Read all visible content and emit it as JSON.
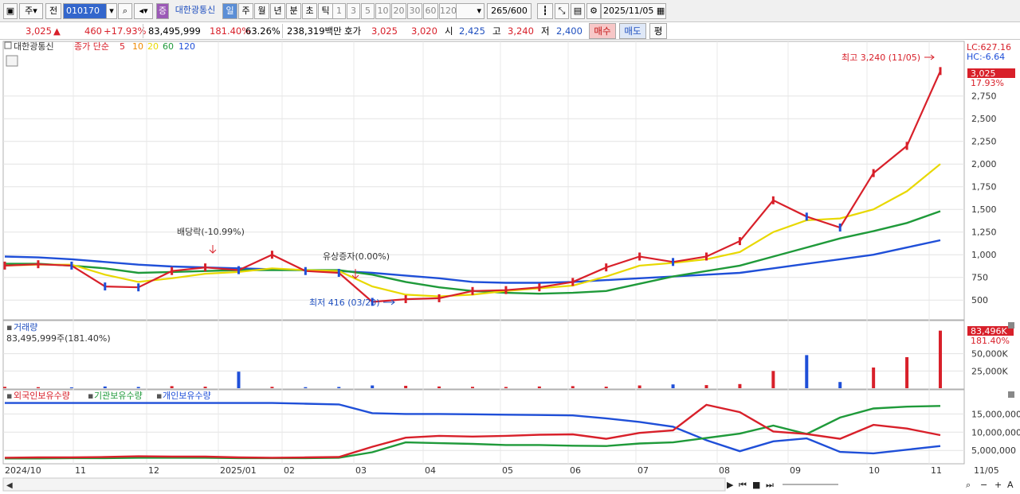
{
  "toolbar": {
    "type_label": "주",
    "prev_label": "전",
    "stock_code": "010170",
    "stock_name": "대한광통신",
    "stock_tag": "증",
    "periods": [
      "일",
      "주",
      "월",
      "년",
      "분",
      "초",
      "틱"
    ],
    "active_period": "일",
    "minute_units": [
      "1",
      "3",
      "5",
      "10",
      "20",
      "30",
      "60",
      "120"
    ],
    "count": "265",
    "count_max": "/600",
    "date": "2025/11/05"
  },
  "quote": {
    "price": "3,025",
    "change": "460",
    "change_pct": "+17.93%",
    "volume": "83,495,999",
    "volume_ratio": "181.40%",
    "turnover": "63.26%",
    "amount": "238,319백만",
    "ask_label": "호가",
    "ask": "3,025",
    "bid": "3,020",
    "open_label": "시",
    "open": "2,425",
    "high_label": "고",
    "high": "3,240",
    "low_label": "저",
    "low": "2,400",
    "buy_label": "매수",
    "sell_label": "매도",
    "eval_label": "평"
  },
  "chart_data": [
    {
      "type": "line",
      "title": "대한광통신",
      "legend_prefix": "종가 단순",
      "ma_periods": [
        "5",
        "10",
        "20",
        "60",
        "120"
      ],
      "colors": {
        "price": "#d8202a",
        "ma5": "#d8202a",
        "ma10": "#f08a00",
        "ma20": "#e8d800",
        "ma60": "#1f9a3a",
        "ma120": "#1f4fd8"
      },
      "lc_label": "LC:627.16",
      "hc_label": "HC:-6.64",
      "y_ticks": [
        "2,750",
        "2,500",
        "2,250",
        "2,000",
        "1,750",
        "1,500",
        "1,250",
        "1,000",
        "750",
        "500"
      ],
      "ylim": [
        300,
        3300
      ],
      "price_badge": "3,025",
      "pct_badge": "17.93%",
      "annotations": {
        "high": "최고 3,240 (11/05)",
        "low": "최저 416 (03/20)",
        "dividend": "배당락(-10.99%)",
        "rights": "유상증자(0.00%)"
      },
      "x": [
        "10/01",
        "10/15",
        "11/01",
        "11/15",
        "12/01",
        "12/15",
        "01/01",
        "01/15",
        "02/01",
        "02/15",
        "03/01",
        "03/20",
        "04/01",
        "04/15",
        "05/01",
        "05/15",
        "06/01",
        "06/15",
        "07/01",
        "07/15",
        "08/01",
        "08/15",
        "09/01",
        "09/15",
        "10/01",
        "10/15",
        "10/25",
        "11/01",
        "11/05"
      ],
      "close": [
        880,
        895,
        880,
        650,
        640,
        820,
        860,
        830,
        1000,
        820,
        800,
        480,
        510,
        520,
        600,
        610,
        640,
        700,
        860,
        980,
        920,
        980,
        1150,
        1600,
        1420,
        1300,
        1900,
        2200,
        3025
      ],
      "ma20": [
        880,
        890,
        890,
        780,
        700,
        740,
        790,
        810,
        850,
        830,
        820,
        650,
        560,
        540,
        560,
        600,
        630,
        660,
        760,
        880,
        910,
        950,
        1030,
        1250,
        1380,
        1400,
        1500,
        1700,
        2000
      ],
      "ma60": [
        900,
        900,
        880,
        850,
        800,
        810,
        820,
        830,
        830,
        830,
        830,
        780,
        700,
        640,
        600,
        580,
        570,
        580,
        600,
        680,
        760,
        820,
        880,
        980,
        1080,
        1180,
        1260,
        1350,
        1480
      ],
      "ma120": [
        980,
        970,
        950,
        920,
        890,
        870,
        860,
        850,
        840,
        830,
        820,
        800,
        770,
        740,
        700,
        690,
        690,
        700,
        720,
        740,
        760,
        780,
        800,
        850,
        900,
        950,
        1000,
        1080,
        1160
      ]
    },
    {
      "type": "bar",
      "title": "거래량",
      "value_label": "83,495,999주(181.40%)",
      "volume_badge": "83,496K",
      "volume_pct": "181.40%",
      "y_ticks": [
        "50,000K",
        "25,000K"
      ],
      "ylim": [
        0,
        90000
      ],
      "values": [
        2000,
        1500,
        1200,
        2500,
        1800,
        3000,
        2200,
        24000,
        2000,
        1500,
        1800,
        4000,
        3500,
        2500,
        2000,
        1800,
        2500,
        3000,
        2200,
        4000,
        5500,
        4500,
        6000,
        25000,
        48000,
        9000,
        30000,
        45000,
        83496
      ]
    },
    {
      "type": "line",
      "series_names": [
        "외국인보유수량",
        "기관보유수량",
        "개인보유수량"
      ],
      "series_colors": [
        "#d8202a",
        "#1f9a3a",
        "#1f4fd8"
      ],
      "y_ticks": [
        "15,000,000",
        "10,000,000",
        "5,000,000"
      ],
      "ylim": [
        2000000,
        19000000
      ],
      "foreign": [
        3000000,
        3100000,
        3100000,
        3200000,
        3400000,
        3300000,
        3300000,
        3100000,
        3000000,
        3100000,
        3200000,
        6000000,
        8500000,
        9000000,
        8800000,
        9000000,
        9300000,
        9400000,
        8200000,
        9800000,
        10500000,
        17500000,
        15500000,
        10200000,
        9500000,
        8200000,
        12000000,
        11000000,
        9200000
      ],
      "institution": [
        2800000,
        2800000,
        2900000,
        2900000,
        3000000,
        3000000,
        3000000,
        2900000,
        2900000,
        2900000,
        3000000,
        4500000,
        7200000,
        7000000,
        6800000,
        6500000,
        6500000,
        6300000,
        6200000,
        6900000,
        7200000,
        8400000,
        9600000,
        11800000,
        9500000,
        14000000,
        16500000,
        17000000,
        17200000
      ],
      "retail": [
        18000000,
        18000000,
        18000000,
        18000000,
        18000000,
        18000000,
        18000000,
        18000000,
        18000000,
        17800000,
        17600000,
        15200000,
        15000000,
        15000000,
        14900000,
        14800000,
        14700000,
        14600000,
        13800000,
        12800000,
        11500000,
        7800000,
        4800000,
        7500000,
        8300000,
        4600000,
        4200000,
        5200000,
        6200000
      ]
    }
  ],
  "x_axis_labels": [
    "2024/10",
    "11",
    "12",
    "2025/01",
    "02",
    "03",
    "04",
    "05",
    "06",
    "07",
    "08",
    "09",
    "10",
    "11",
    "11/05"
  ]
}
